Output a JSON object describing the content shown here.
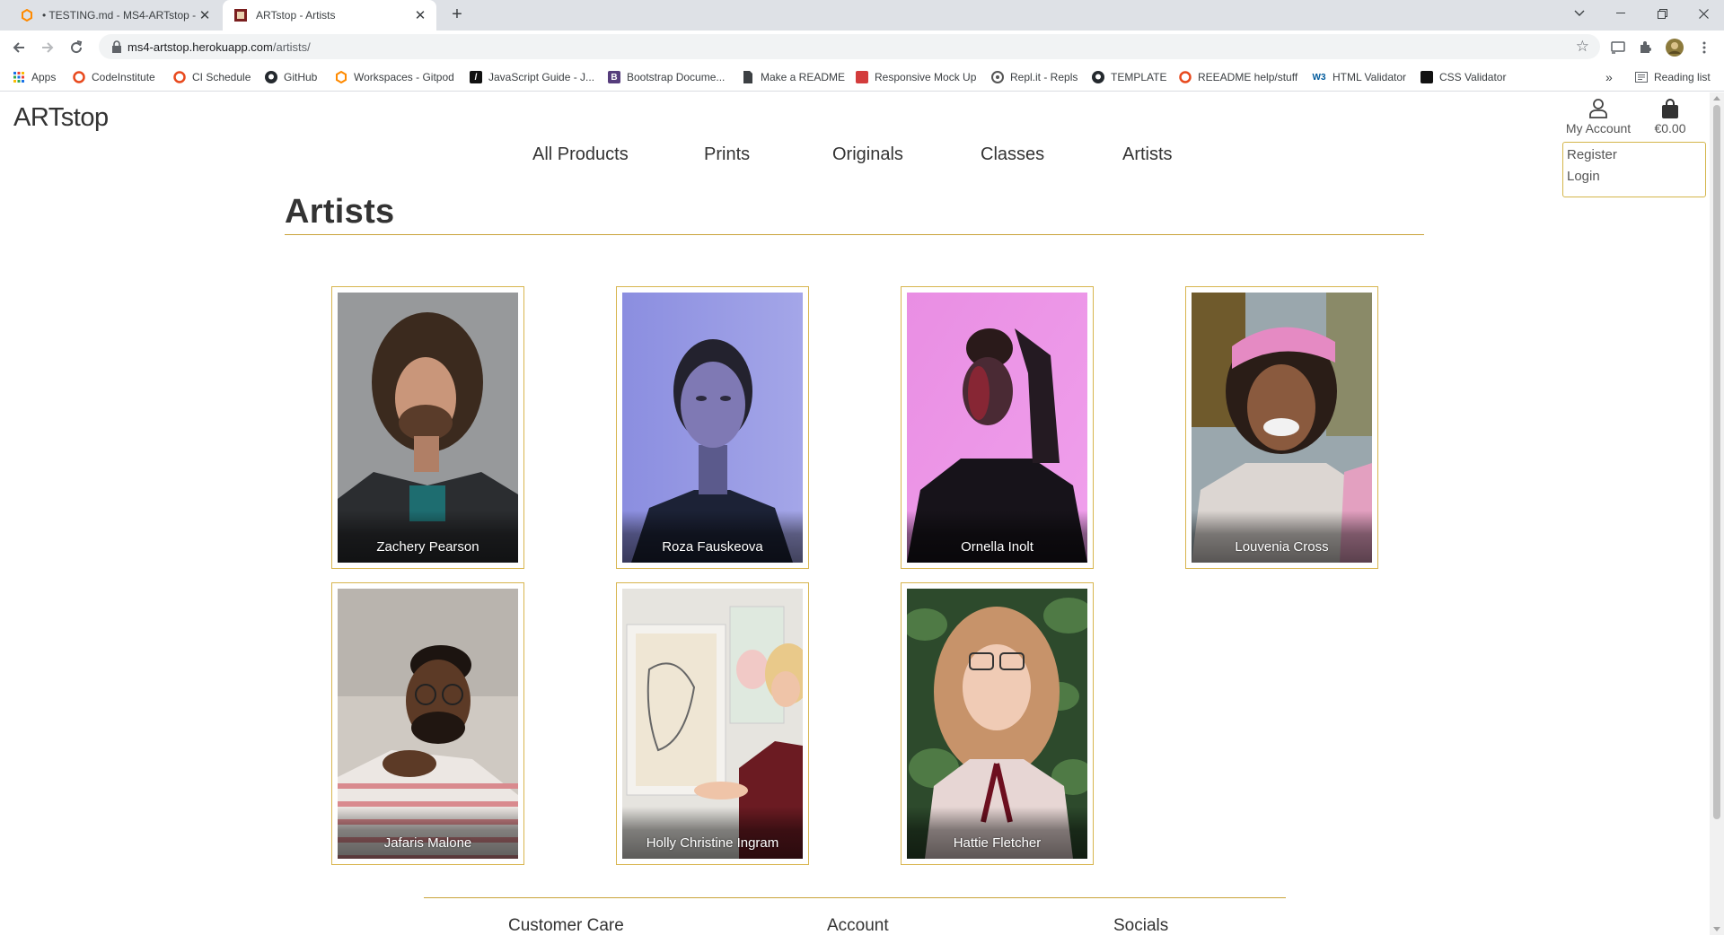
{
  "browser": {
    "tabs": [
      {
        "title": "• TESTING.md - MS4-ARTstop - ",
        "icon": "gitpod-icon"
      },
      {
        "title": "ARTstop - Artists",
        "icon": "artstop-favicon"
      }
    ],
    "url_host": "ms4-artstop.herokuapp.com",
    "url_path": "/artists/",
    "bookmarks": [
      {
        "label": "Apps",
        "icon": "apps-grid-icon"
      },
      {
        "label": "CodeInstitute",
        "icon": "codeinstitute-icon"
      },
      {
        "label": "CI Schedule",
        "icon": "codeinstitute-icon"
      },
      {
        "label": "GitHub",
        "icon": "github-icon"
      },
      {
        "label": "Workspaces - Gitpod",
        "icon": "gitpod-icon"
      },
      {
        "label": "JavaScript Guide - J...",
        "icon": "mdn-icon"
      },
      {
        "label": "Bootstrap Docume...",
        "icon": "bootstrap-icon"
      },
      {
        "label": "Make a README",
        "icon": "document-icon"
      },
      {
        "label": "Responsive Mock Up",
        "icon": "mockup-icon"
      },
      {
        "label": "Repl.it - Repls",
        "icon": "replit-icon"
      },
      {
        "label": "TEMPLATE",
        "icon": "github-icon"
      },
      {
        "label": "REEADME help/stuff",
        "icon": "codeinstitute-icon"
      },
      {
        "label": "HTML Validator",
        "icon": "w3c-icon"
      },
      {
        "label": "CSS Validator",
        "icon": "css-validator-icon"
      }
    ],
    "more_bookmarks": "»",
    "reading_list": "Reading list"
  },
  "site": {
    "brand": "ARTstop",
    "nav": [
      "All Products",
      "Prints",
      "Originals",
      "Classes",
      "Artists"
    ],
    "account_label": "My Account",
    "cart_total": "€0.00",
    "account_menu": [
      "Register",
      "Login"
    ]
  },
  "page": {
    "title": "Artists",
    "artists": [
      {
        "name": "Zachery Pearson"
      },
      {
        "name": "Roza Fauskeova"
      },
      {
        "name": "Ornella Inolt"
      },
      {
        "name": "Louvenia Cross"
      },
      {
        "name": "Jafaris Malone"
      },
      {
        "name": "Holly Christine Ingram"
      },
      {
        "name": "Hattie Fletcher"
      }
    ]
  },
  "footer": {
    "headings": [
      "Customer Care",
      "Account",
      "Socials"
    ]
  },
  "colors": {
    "accent_gold": "#c9a33a",
    "card_border": "#d8b54e",
    "text": "#333333"
  }
}
